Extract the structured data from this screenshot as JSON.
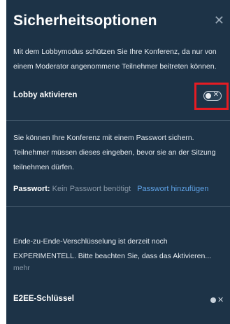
{
  "dialog": {
    "title": "Sicherheitsoptionen",
    "close_icon": "close-icon"
  },
  "lobby": {
    "description_line1": "Mit dem Lobbymodus schützen Sie Ihre Konferenz, da nur von",
    "description_line2": "einem Moderator angenommene Teilnehmer beitreten können.",
    "label": "Lobby aktivieren",
    "toggle_state": "off",
    "toggle_x": "✕"
  },
  "password": {
    "description_line1": "Sie können Ihre Konferenz mit einem Passwort sichern.",
    "description_line2": "Teilnehmer müssen dieses eingeben, bevor sie an der Sitzung",
    "description_line3": "teilnehmen dürfen.",
    "label": "Passwort:",
    "value": "Kein Passwort benötigt",
    "add_link": "Passwort hinzufügen"
  },
  "e2ee": {
    "description_line1": "Ende-zu-Ende-Verschlüsselung ist derzeit noch",
    "description_line2": "EXPERIMENTELL. Bitte beachten Sie, dass das Aktivieren...",
    "more_link": "mehr",
    "label": "E2EE-Schlüssel",
    "toggle_state": "off",
    "toggle_x": "✕"
  },
  "colors": {
    "panel_background": "#1d3347",
    "highlight": "#e51c23",
    "link": "#5fa3e8"
  }
}
